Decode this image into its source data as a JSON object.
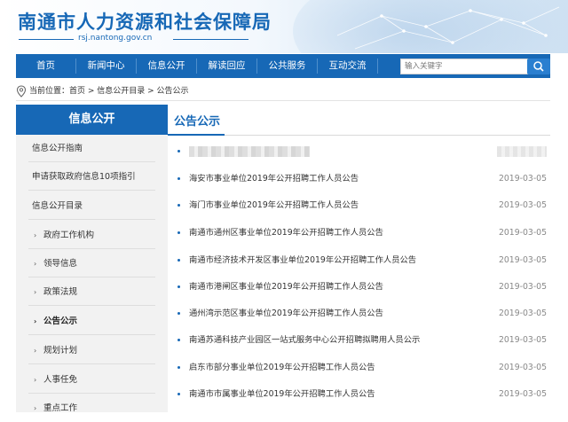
{
  "header": {
    "site_title": "南通市人力资源和社会保障局",
    "site_domain": "rsj.nantong.gov.cn"
  },
  "nav": {
    "items": [
      "首页",
      "新闻中心",
      "信息公开",
      "解读回应",
      "公共服务",
      "互动交流"
    ],
    "search_placeholder": "输入关键字"
  },
  "breadcrumb": {
    "text": "当前位置：首页 > 信息公开目录 > 公告公示"
  },
  "sidebar": {
    "heading": "信息公开",
    "items": [
      {
        "label": "信息公开指南",
        "sub": false,
        "active": false
      },
      {
        "label": "申请获取政府信息10项指引",
        "sub": false,
        "active": false
      },
      {
        "label": "信息公开目录",
        "sub": false,
        "active": false
      },
      {
        "label": "政府工作机构",
        "sub": true,
        "active": false
      },
      {
        "label": "领导信息",
        "sub": true,
        "active": false
      },
      {
        "label": "政策法规",
        "sub": true,
        "active": false
      },
      {
        "label": "公告公示",
        "sub": true,
        "active": true
      },
      {
        "label": "规划计划",
        "sub": true,
        "active": false
      },
      {
        "label": "人事任免",
        "sub": true,
        "active": false
      },
      {
        "label": "重点工作",
        "sub": true,
        "active": false
      }
    ],
    "arrow_glyph": "›"
  },
  "main": {
    "title": "公告公示",
    "items": [
      {
        "title": "海安市事业单位2019年公开招聘工作人员公告",
        "date": "2019-03-05"
      },
      {
        "title": "海门市事业单位2019年公开招聘工作人员公告",
        "date": "2019-03-05"
      },
      {
        "title": "南通市通州区事业单位2019年公开招聘工作人员公告",
        "date": "2019-03-05"
      },
      {
        "title": "南通市经济技术开发区事业单位2019年公开招聘工作人员公告",
        "date": "2019-03-05"
      },
      {
        "title": "南通市港闸区事业单位2019年公开招聘工作人员公告",
        "date": "2019-03-05"
      },
      {
        "title": "通州湾示范区事业单位2019年公开招聘工作人员公告",
        "date": "2019-03-05"
      },
      {
        "title": "南通苏通科技产业园区一站式服务中心公开招聘拟聘用人员公示",
        "date": "2019-03-05"
      },
      {
        "title": "启东市部分事业单位2019年公开招聘工作人员公告",
        "date": "2019-03-05"
      },
      {
        "title": "南通市市属事业单位2019年公开招聘工作人员公告",
        "date": "2019-03-05"
      }
    ]
  },
  "colors": {
    "brand_blue": "#1768b6",
    "sidebar_bg": "#f2f2f2"
  },
  "icons": [
    "location-pin-icon",
    "search-icon",
    "bullet-dot-icon",
    "chevron-right-icon"
  ]
}
